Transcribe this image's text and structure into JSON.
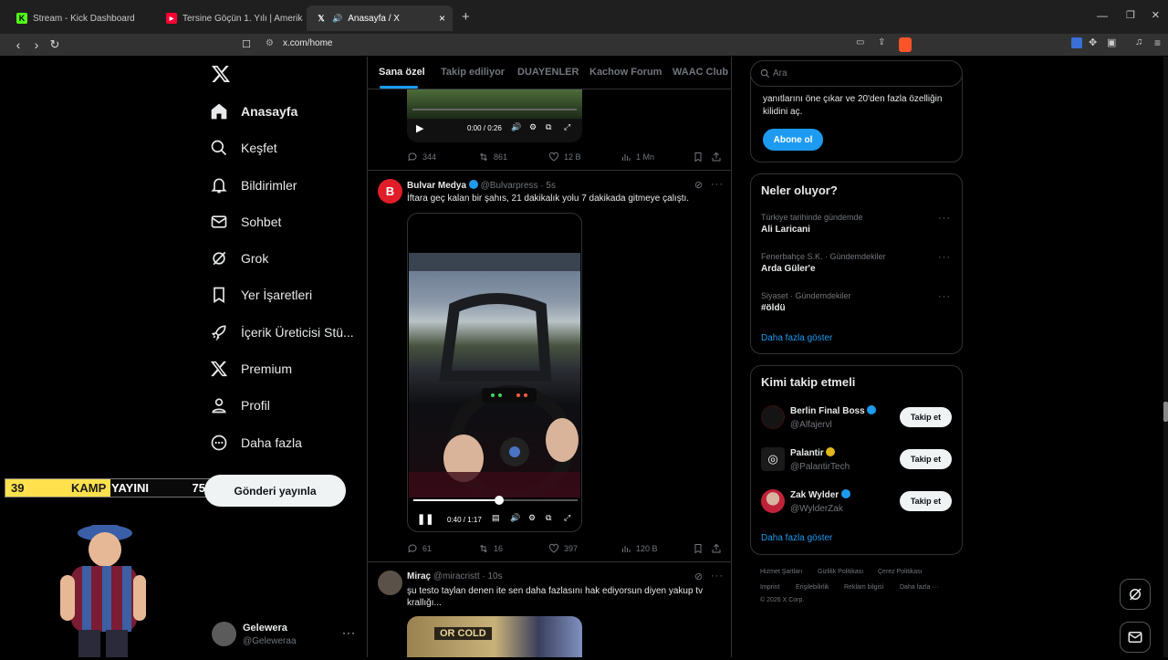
{
  "browser": {
    "tabs": [
      {
        "title": "Stream - Kick Dashboard",
        "favicon": "kick-icon"
      },
      {
        "title": "Tersine Göçün 1. Yılı | Amerika vs Türk",
        "favicon": "youtube-icon"
      },
      {
        "title": "Anasayfa / X",
        "favicon": "x-icon"
      }
    ],
    "url": "x.com/home"
  },
  "sidebar": {
    "items": [
      {
        "label": "Anasayfa",
        "icon": "home-icon"
      },
      {
        "label": "Keşfet",
        "icon": "search-icon"
      },
      {
        "label": "Bildirimler",
        "icon": "bell-icon"
      },
      {
        "label": "Sohbet",
        "icon": "mail-icon"
      },
      {
        "label": "Grok",
        "icon": "grok-icon"
      },
      {
        "label": "Yer İşaretleri",
        "icon": "bookmark-icon"
      },
      {
        "label": "İçerik Üreticisi Stü...",
        "icon": "rocket-icon"
      },
      {
        "label": "Premium",
        "icon": "x-icon"
      },
      {
        "label": "Profil",
        "icon": "person-icon"
      },
      {
        "label": "Daha fazla",
        "icon": "more-circle-icon"
      }
    ],
    "post_button": "Gönderi yayınla",
    "user": {
      "name": "Gelewera",
      "handle": "@Geleweraa"
    }
  },
  "overlay": {
    "left_num": "39",
    "label1": "KAMP",
    "label2": "YAYINI",
    "right_num": "75"
  },
  "feed": {
    "tabs": [
      "Sana özel",
      "Takip ediliyor",
      "DUAYENLER",
      "Kachow Forum",
      "WAAC Club"
    ],
    "post1": {
      "video_time": "0:00 / 0:26",
      "replies": "344",
      "reposts": "861",
      "likes": "12 B",
      "views": "1 Mn"
    },
    "post2": {
      "name": "Bulvar Medya",
      "handle": "@Bulvarpress",
      "time": "· 5s",
      "text": "İftara geç kalan bir şahıs, 21 dakikalık yolu 7 dakikada gitmeye çalıştı.",
      "video_time": "0:40 / 1:17",
      "progress": 0.52,
      "replies": "61",
      "reposts": "16",
      "likes": "397",
      "views": "120 B"
    },
    "post3": {
      "name": "Miraç",
      "handle": "@miracristt",
      "time": "· 10s",
      "text": "şu testo taylan denen ite sen daha fazlasını hak ediyorsun diyen yakup tv krallığı...",
      "image_text": "OR COLD"
    }
  },
  "right": {
    "search_placeholder": "Ara",
    "premium_text_line1": "yanıtlarını öne çıkar ve 20'den fazla özelliğin",
    "premium_text_line2": "kilidini aç.",
    "subscribe": "Abone ol",
    "trends_title": "Neler oluyor?",
    "trends": [
      {
        "context": "Türkiye tarihinde gündemde",
        "name": "Ali Laricani"
      },
      {
        "context": "Fenerbahçe S.K. · Gündemdekiler",
        "name": "Arda Güler'e"
      },
      {
        "context": "Siyaset · Gündemdekiler",
        "name": "#öldü"
      }
    ],
    "show_more": "Daha fazla göster",
    "follow_title": "Kimi takip etmeli",
    "follow": [
      {
        "name": "Berlin Final Boss",
        "handle": "@Alfajervl",
        "badge": "#1d9bf0"
      },
      {
        "name": "Palantir",
        "handle": "@PalantirTech",
        "badge": "#e2b719"
      },
      {
        "name": "Zak Wylder",
        "handle": "@WylderZak",
        "badge": "#1d9bf0"
      }
    ],
    "follow_btn": "Takip et",
    "footer": [
      "Hizmet Şartları",
      "Gizlilik Politikası",
      "Çerez Politikası",
      "Imprint",
      "Erişilebilirlik",
      "Reklam bilgisi",
      "Daha fazla ···",
      "© 2026 X Corp."
    ]
  },
  "colors": {
    "accent": "#1d9bf0",
    "bg": "#000000",
    "border": "#2f3336",
    "muted": "#71767b"
  }
}
